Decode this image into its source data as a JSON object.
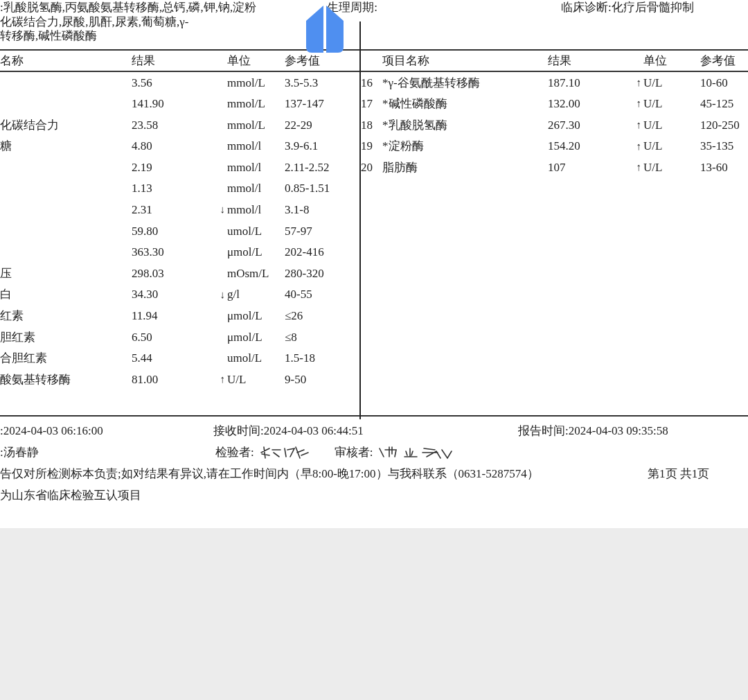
{
  "header": {
    "items_lines": [
      ":乳酸脱氢酶,丙氨酸氨基转移酶,总钙,磷,钾,钠,淀粉",
      "化碳结合力,尿酸,肌酐,尿素,葡萄糖,γ-",
      "转移酶,碱性磷酸酶"
    ],
    "cycle_label": "生理周期:",
    "diagnosis": "临床诊断:化疗后骨髓抑制"
  },
  "left_table": {
    "columns": [
      "名称",
      "结果",
      "单位",
      "参考值"
    ],
    "rows": [
      {
        "name": "",
        "result": "3.56",
        "flag": "",
        "unit": "mmol/L",
        "reference": "3.5-5.3"
      },
      {
        "name": "",
        "result": "141.90",
        "flag": "",
        "unit": "mmol/L",
        "reference": "137-147"
      },
      {
        "name": "化碳结合力",
        "result": "23.58",
        "flag": "",
        "unit": "mmol/L",
        "reference": "22-29"
      },
      {
        "name": "糖",
        "result": "4.80",
        "flag": "",
        "unit": "mmol/l",
        "reference": "3.9-6.1"
      },
      {
        "name": "",
        "result": "2.19",
        "flag": "",
        "unit": "mmol/l",
        "reference": "2.11-2.52"
      },
      {
        "name": "",
        "result": "1.13",
        "flag": "",
        "unit": "mmol/l",
        "reference": "0.85-1.51"
      },
      {
        "name": "",
        "result": "2.31",
        "flag": "↓",
        "unit": "mmol/l",
        "reference": "3.1-8"
      },
      {
        "name": "",
        "result": "59.80",
        "flag": "",
        "unit": "umol/L",
        "reference": "57-97"
      },
      {
        "name": "",
        "result": "363.30",
        "flag": "",
        "unit": "μmol/L",
        "reference": "202-416"
      },
      {
        "name": "压",
        "result": "298.03",
        "flag": "",
        "unit": "mOsm/L",
        "reference": "280-320"
      },
      {
        "name": "白",
        "result": "34.30",
        "flag": "↓",
        "unit": "g/l",
        "reference": "40-55"
      },
      {
        "name": "红素",
        "result": "11.94",
        "flag": "",
        "unit": "μmol/L",
        "reference": "≤26"
      },
      {
        "name": "胆红素",
        "result": "6.50",
        "flag": "",
        "unit": "μmol/L",
        "reference": "≤8"
      },
      {
        "name": "合胆红素",
        "result": "5.44",
        "flag": "",
        "unit": "umol/L",
        "reference": "1.5-18"
      },
      {
        "name": "酸氨基转移酶",
        "result": "81.00",
        "flag": "↑",
        "unit": "U/L",
        "reference": "9-50"
      }
    ]
  },
  "right_table": {
    "columns": [
      "项目名称",
      "结果",
      "单位",
      "参考值"
    ],
    "rows": [
      {
        "no": "16",
        "name": "*γ-谷氨酰基转移酶",
        "result": "187.10",
        "flag": "↑",
        "unit": "U/L",
        "reference": "10-60"
      },
      {
        "no": "17",
        "name": "*碱性磷酸酶",
        "result": "132.00",
        "flag": "↑",
        "unit": "U/L",
        "reference": "45-125"
      },
      {
        "no": "18",
        "name": "*乳酸脱氢酶",
        "result": "267.30",
        "flag": "↑",
        "unit": "U/L",
        "reference": "120-250"
      },
      {
        "no": "19",
        "name": "*淀粉酶",
        "result": "154.20",
        "flag": "↑",
        "unit": "U/L",
        "reference": "35-135"
      },
      {
        "no": "20",
        "name": "脂肪酶",
        "result": "107",
        "flag": "↑",
        "unit": "U/L",
        "reference": "13-60"
      }
    ]
  },
  "footer": {
    "collect_time": ":2024-04-03 06:16:00",
    "receive_time": "接收时间:2024-04-03 06:44:51",
    "report_time": "报告时间:2024-04-03 09:35:58",
    "collector": ":汤春静",
    "tester_label": "检验者:",
    "reviewer_label": "审核者:",
    "disclaimer": "告仅对所检测标本负责;如对结果有异议,请在工作时间内（早8:00-晚17:00）与我科联系（0631-5287574）",
    "page": "第1页 共1页",
    "note": "为山东省临床检验互认项目"
  }
}
